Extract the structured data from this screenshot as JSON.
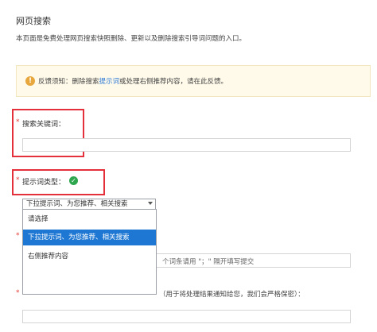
{
  "header": {
    "title": "网页搜索",
    "description": "本页面是免费处理网页搜索快照删除、更新以及删除搜索引导词问题的入口。"
  },
  "notice": {
    "prefix": "反馈须知：删除搜索",
    "link": "提示词",
    "suffix": "或处理右侧推荐内容，请在此反馈。"
  },
  "form": {
    "required_mark": "*",
    "keyword_label": "搜索关键词：",
    "keyword_value": "",
    "hint_type_label": "提示词类型：",
    "select_value": "下拉提示词、为您推荐、相关搜索",
    "options": [
      "请选择",
      "下拉提示词、为您推荐、相关搜索",
      "右侧推荐内容"
    ],
    "partial_hint": "个词条请用 \"；\" 隔开填写提交",
    "email_label_partial": "（用于将处理结果通知给您，我们会严格保密）："
  },
  "colors": {
    "accent": "#1e77d2",
    "required": "#e53935",
    "highlight_frame": "#e3303a",
    "success": "#2ea64e",
    "notice_bg": "#fffaea",
    "warning": "#e7a73d"
  }
}
